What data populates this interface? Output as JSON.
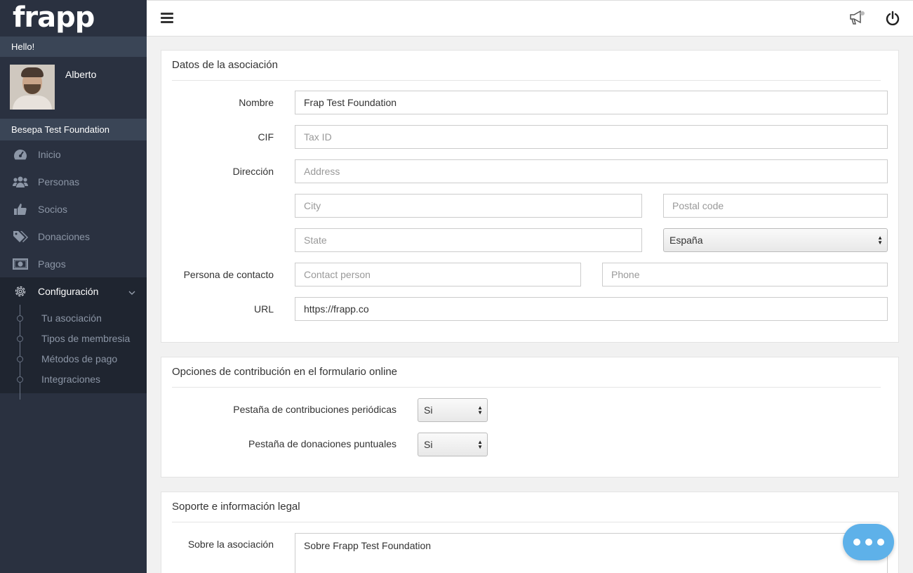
{
  "brand": {
    "logo_text": "frapp"
  },
  "user": {
    "greeting": "Hello!",
    "name": "Alberto",
    "organization": "Besepa Test Foundation"
  },
  "nav": {
    "items": [
      {
        "label": "Inicio",
        "icon": "dashboard-icon"
      },
      {
        "label": "Personas",
        "icon": "users-icon"
      },
      {
        "label": "Socios",
        "icon": "thumbs-up-icon"
      },
      {
        "label": "Donaciones",
        "icon": "tags-icon"
      },
      {
        "label": "Pagos",
        "icon": "money-icon"
      },
      {
        "label": "Configuración",
        "icon": "gear-icon",
        "active": true
      }
    ],
    "subitems": [
      {
        "label": "Tu asociación"
      },
      {
        "label": "Tipos de membresia"
      },
      {
        "label": "Métodos de pago"
      },
      {
        "label": "Integraciones"
      }
    ]
  },
  "topbar": {
    "menu_icon": "hamburger-icon",
    "announce_icon": "megaphone-icon",
    "logout_icon": "power-icon"
  },
  "association": {
    "title": "Datos de la asociación",
    "labels": {
      "name": "Nombre",
      "cif": "CIF",
      "address": "Dirección",
      "contact": "Persona de contacto",
      "url": "URL"
    },
    "fields": {
      "name": {
        "value": "Frap Test Foundation",
        "placeholder": ""
      },
      "cif": {
        "value": "",
        "placeholder": "Tax ID"
      },
      "address": {
        "value": "",
        "placeholder": "Address"
      },
      "city": {
        "value": "",
        "placeholder": "City"
      },
      "postal_code": {
        "value": "",
        "placeholder": "Postal code"
      },
      "state": {
        "value": "",
        "placeholder": "State"
      },
      "country": {
        "value": "España"
      },
      "contact_person": {
        "value": "",
        "placeholder": "Contact person"
      },
      "phone": {
        "value": "",
        "placeholder": "Phone"
      },
      "url": {
        "value": "https://frapp.co",
        "placeholder": ""
      }
    }
  },
  "contribution": {
    "title": "Opciones de contribución en el formulario online",
    "periodic_label": "Pestaña de contribuciones periódicas",
    "periodic_value": "Si",
    "oneoff_label": "Pestaña de donaciones puntuales",
    "oneoff_value": "Si"
  },
  "legal": {
    "title": "Soporte e información legal",
    "about_label": "Sobre la asociación",
    "about_value": "Sobre Frapp Test Foundation"
  },
  "chat": {
    "icon": "chat-bubble-icon"
  },
  "colors": {
    "sidebar": "#2a3140",
    "sidebar_active": "#1f2530",
    "accent_chat": "#5eb1e9"
  }
}
